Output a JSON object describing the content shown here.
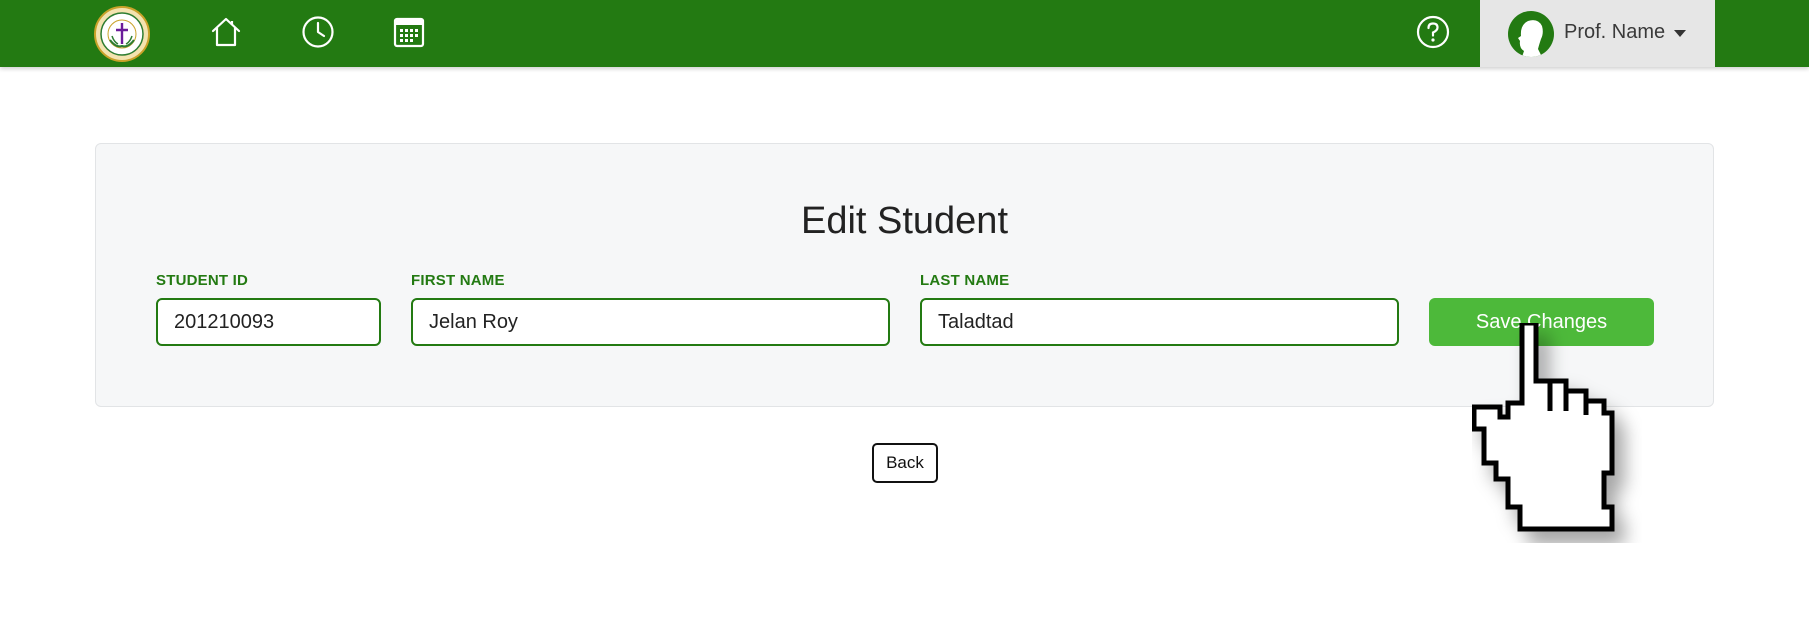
{
  "header": {
    "logo_icon": "school-seal-logo",
    "nav_icons": [
      "home-icon",
      "clock-icon",
      "calendar-icon"
    ],
    "help_icon": "question-circle-icon",
    "user_name": "Prof. Name",
    "brand_color": "#237a12"
  },
  "form": {
    "title": "Edit Student",
    "student_id_label": "STUDENT ID",
    "student_id_value": "201210093",
    "first_name_label": "FIRST NAME",
    "first_name_value": "Jelan Roy",
    "last_name_label": "LAST NAME",
    "last_name_value": "Taladtad",
    "save_label": "Save Changes",
    "save_color": "#4db93a"
  },
  "footer": {
    "back_label": "Back"
  },
  "cursor": {
    "icon": "hand-pointer-cursor"
  }
}
